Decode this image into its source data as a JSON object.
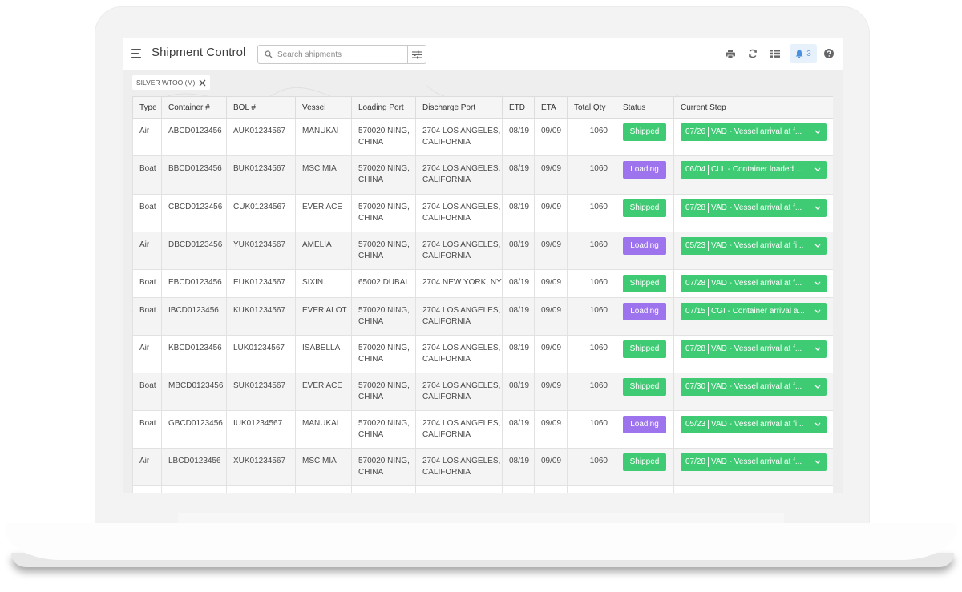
{
  "app": {
    "title": "Shipment Control",
    "search_placeholder": "Search shipments",
    "notification_count": "3"
  },
  "icons": {
    "menu": "hamburger-menu-icon",
    "search": "search-icon",
    "filter": "sliders-filter-icon",
    "print": "print-icon",
    "refresh": "refresh-icon",
    "list": "list-view-icon",
    "bell": "bell-icon",
    "help": "help-icon",
    "chip_close": "close-icon",
    "step_dropdown": "chevron-down-icon"
  },
  "colors": {
    "shipped": "#3ecb73",
    "loading": "#9d74ee",
    "step": "#3ecb73",
    "notification_bg": "#e7f1fc",
    "notification_fg": "#6b9bd6"
  },
  "filter_chips": [
    {
      "label": "SILVER WTOO (M)"
    }
  ],
  "table": {
    "columns": [
      "Type",
      "Container #",
      "BOL #",
      "Vessel",
      "Loading Port",
      "Discharge Port",
      "ETD",
      "ETA",
      "Total Qty",
      "Status",
      "Current Step"
    ],
    "rows": [
      {
        "type": "Air",
        "container": "ABCD0123456",
        "bol": "AUK01234567",
        "vessel": "MANUKAI",
        "loading_port": [
          "570020 NING,",
          "CHINA"
        ],
        "discharge_port": [
          "2704 LOS ANGELES,",
          "CALIFORNIA"
        ],
        "etd": "08/19",
        "eta": "09/09",
        "qty": "1060",
        "status": "Shipped",
        "step_date": "07/26",
        "step_text": "VAD - Vessel arrival at f..."
      },
      {
        "type": "Boat",
        "container": "BBCD0123456",
        "bol": "BUK01234567",
        "vessel": "MSC MIA",
        "loading_port": [
          "570020 NING,",
          "CHINA"
        ],
        "discharge_port": [
          "2704 LOS ANGELES,",
          "CALIFORNIA"
        ],
        "etd": "08/19",
        "eta": "09/09",
        "qty": "1060",
        "status": "Loading",
        "step_date": "06/04",
        "step_text": "CLL - Container loaded ..."
      },
      {
        "type": "Boat",
        "container": "CBCD0123456",
        "bol": "CUK01234567",
        "vessel": "EVER ACE",
        "loading_port": [
          "570020 NING,",
          "CHINA"
        ],
        "discharge_port": [
          "2704 LOS ANGELES,",
          "CALIFORNIA"
        ],
        "etd": "08/19",
        "eta": "09/09",
        "qty": "1060",
        "status": "Shipped",
        "step_date": "07/28",
        "step_text": "VAD - Vessel arrival at f..."
      },
      {
        "type": "Air",
        "container": "DBCD0123456",
        "bol": "YUK01234567",
        "vessel": "AMELIA",
        "loading_port": [
          "570020 NING,",
          "CHINA"
        ],
        "discharge_port": [
          "2704 LOS ANGELES,",
          "CALIFORNIA"
        ],
        "etd": "08/19",
        "eta": "09/09",
        "qty": "1060",
        "status": "Loading",
        "step_date": "05/23",
        "step_text": "VAD - Vessel arrival at fi..."
      },
      {
        "type": "Boat",
        "container": "EBCD0123456",
        "bol": "EUK01234567",
        "vessel": "SIXIN",
        "loading_port": [
          "65002 DUBAI"
        ],
        "discharge_port": [
          "2704 NEW YORK, NY"
        ],
        "etd": "08/19",
        "eta": "09/09",
        "qty": "1060",
        "status": "Shipped",
        "step_date": "07/28",
        "step_text": "VAD - Vessel arrival at f..."
      },
      {
        "type": "Boat",
        "container": "IBCD0123456",
        "bol": "KUK01234567",
        "vessel": "EVER ALOT",
        "loading_port": [
          "570020 NING,",
          "CHINA"
        ],
        "discharge_port": [
          "2704 LOS ANGELES,",
          "CALIFORNIA"
        ],
        "etd": "08/19",
        "eta": "09/09",
        "qty": "1060",
        "status": "Loading",
        "step_date": "07/15",
        "step_text": "CGI - Container arrival a..."
      },
      {
        "type": "Air",
        "container": "KBCD0123456",
        "bol": "LUK01234567",
        "vessel": "ISABELLA",
        "loading_port": [
          "570020 NING,",
          "CHINA"
        ],
        "discharge_port": [
          "2704 LOS ANGELES,",
          "CALIFORNIA"
        ],
        "etd": "08/19",
        "eta": "09/09",
        "qty": "1060",
        "status": "Shipped",
        "step_date": "07/28",
        "step_text": "VAD - Vessel arrival at f..."
      },
      {
        "type": "Boat",
        "container": "MBCD0123456",
        "bol": "SUK01234567",
        "vessel": "EVER ACE",
        "loading_port": [
          "570020 NING,",
          "CHINA"
        ],
        "discharge_port": [
          "2704 LOS ANGELES,",
          "CALIFORNIA"
        ],
        "etd": "08/19",
        "eta": "09/09",
        "qty": "1060",
        "status": "Shipped",
        "step_date": "07/30",
        "step_text": "VAD - Vessel arrival at f..."
      },
      {
        "type": "Boat",
        "container": "GBCD0123456",
        "bol": "IUK01234567",
        "vessel": "MANUKAI",
        "loading_port": [
          "570020 NING,",
          "CHINA"
        ],
        "discharge_port": [
          "2704 LOS ANGELES,",
          "CALIFORNIA"
        ],
        "etd": "08/19",
        "eta": "09/09",
        "qty": "1060",
        "status": "Loading",
        "step_date": "05/23",
        "step_text": "VAD - Vessel arrival at fi..."
      },
      {
        "type": "Air",
        "container": "LBCD0123456",
        "bol": "XUK01234567",
        "vessel": "MSC MIA",
        "loading_port": [
          "570020 NING,",
          "CHINA"
        ],
        "discharge_port": [
          "2704 LOS ANGELES,",
          "CALIFORNIA"
        ],
        "etd": "08/19",
        "eta": "09/09",
        "qty": "1060",
        "status": "Shipped",
        "step_date": "07/28",
        "step_text": "VAD - Vessel arrival at f..."
      }
    ]
  }
}
